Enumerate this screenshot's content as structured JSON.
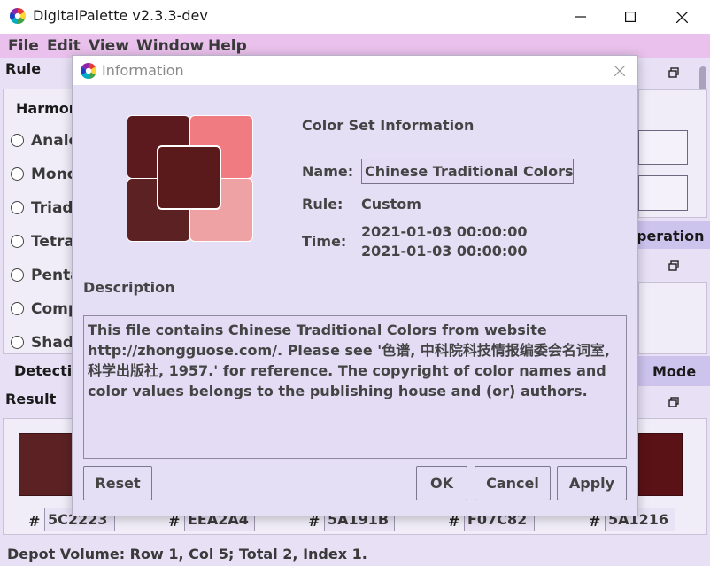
{
  "app": {
    "title": "DigitalPalette v2.3.3-dev"
  },
  "menubar": {
    "items": [
      "File",
      "Edit",
      "View",
      "Window",
      "Help"
    ]
  },
  "background": {
    "rule_section": "Rule",
    "harmony_label": "Harmon",
    "rules": [
      "Analo",
      "Mono",
      "Triad",
      "Tetrac",
      "Penta",
      "Comp",
      "Shade"
    ],
    "operation_label": "peration",
    "detection_label": "Detectio",
    "mode_label": "Mode",
    "result_section": "Result",
    "hex_values": [
      "5C2223",
      "EEA2A4",
      "5A191B",
      "F07C82",
      "5A1216"
    ],
    "hex_prefix": "#",
    "status": "Depot Volume: Row 1, Col 5; Total 2, Index 1.",
    "swatch_colors": {
      "left": "#5c2223",
      "right": "#5a1216"
    }
  },
  "dialog": {
    "title": "Information",
    "section_title": "Color Set Information",
    "name_label": "Name:",
    "name_value": "Chinese Traditional Colors",
    "rule_label": "Rule:",
    "rule_value": "Custom",
    "time_label": "Time:",
    "time_created": "2021-01-03 00:00:00",
    "time_modified": "2021-01-03 00:00:00",
    "description_label": "Description",
    "description": "This file contains Chinese Traditional Colors from website http://zhongguose.com/. Please see '色谱, 中科院科技情报编委会名词室, 科学出版社, 1957.' for reference. The copyright of color names and color values belongs to the publishing house and (or) authors.",
    "buttons": {
      "reset": "Reset",
      "ok": "OK",
      "cancel": "Cancel",
      "apply": "Apply"
    },
    "swatches": {
      "top_left": "#5c1a1e",
      "top_right": "#f07c82",
      "bottom_left": "#5c2223",
      "bottom_right": "#eea2a4",
      "center": "#5a191b"
    }
  },
  "icons": {
    "app_logo": "color-wheel-icon",
    "minimize": "minimize-icon",
    "maximize": "maximize-icon",
    "close": "close-icon",
    "float": "float-window-icon"
  }
}
